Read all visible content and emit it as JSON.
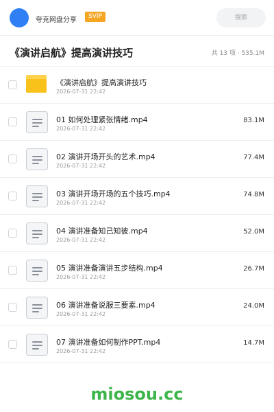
{
  "header": {
    "username": "夸克网盘分享",
    "vip_badge": "SVIP",
    "search_placeholder": "搜索",
    "accent_color": "#2f80f5",
    "vip_color": "#f5a623"
  },
  "folder": {
    "title": "《演讲启航》提高演讲技巧",
    "summary": "共 13 项 · 535.1M"
  },
  "files": [
    {
      "name": "《演讲启航》提高演讲技巧",
      "date": "2026-07-31 22:42",
      "size": "",
      "icon": "folder-icon"
    },
    {
      "name": "01 如何处理紧张情绪.mp4",
      "date": "2026-07-31 22:42",
      "size": "83.1M",
      "icon": "file-doc-icon"
    },
    {
      "name": "02 演讲开场开头的艺术.mp4",
      "date": "2026-07-31 22:42",
      "size": "77.4M",
      "icon": "file-doc-icon"
    },
    {
      "name": "03 演讲开场开场的五个技巧.mp4",
      "date": "2026-07-31 22:42",
      "size": "74.8M",
      "icon": "file-doc-icon"
    },
    {
      "name": "04 演讲准备知己知彼.mp4",
      "date": "2026-07-31 22:42",
      "size": "52.0M",
      "icon": "file-doc-icon"
    },
    {
      "name": "05 演讲准备演讲五步结构.mp4",
      "date": "2026-07-31 22:42",
      "size": "26.7M",
      "icon": "file-doc-icon"
    },
    {
      "name": "06 演讲准备说服三要素.mp4",
      "date": "2026-07-31 22:42",
      "size": "24.0M",
      "icon": "file-doc-icon"
    },
    {
      "name": "07 演讲准备如何制作PPT.mp4",
      "date": "2026-07-31 22:42",
      "size": "14.7M",
      "icon": "file-doc-icon"
    }
  ],
  "watermark": "miosou.cc"
}
